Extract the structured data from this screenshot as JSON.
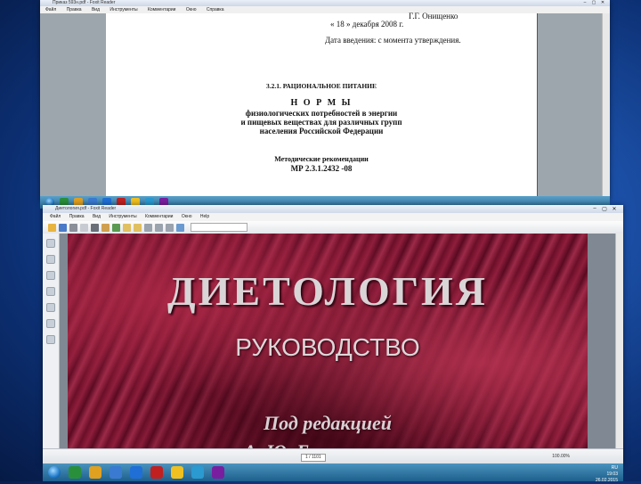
{
  "top_window": {
    "title": "Приказ 593н.pdf - Foxit Reader",
    "menu": [
      "Файл",
      "Правка",
      "Вид",
      "Инструменты",
      "Комментарии",
      "Окно",
      "Справка"
    ],
    "document": {
      "signatory": "Г.Г. Онищенко",
      "date_line": "«   18   » декабря 2008 г.",
      "effective": "Дата введения: с момента утверждения.",
      "section": "3.2.1. РАЦИОНАЛЬНОЕ ПИТАНИЕ",
      "heading": "Н О Р М Ы",
      "subtitle_1": "физиологических потребностей в энергии",
      "subtitle_2": "и пищевых веществах для различных групп",
      "subtitle_3": "населения Российской Федерации",
      "method_1": "Методические рекомендации",
      "method_2": "МР 2.3.1.2432 -08"
    }
  },
  "bottom_window": {
    "title": "Диетология.pdf - Foxit Reader",
    "menu": [
      "Файл",
      "Правка",
      "Вид",
      "Инструменты",
      "Комментарии",
      "Окно",
      "Help"
    ],
    "cover": {
      "title": "ДИЕТОЛОГИЯ",
      "subtitle": "РУКОВОДСТВО",
      "editor_line_1": "Под редакцией",
      "editor_line_2": "А. Ю. Барановского"
    },
    "status": {
      "page": "1 / 1101",
      "zoom": "100.00%"
    }
  },
  "taskbar": {
    "time": "19:03",
    "date": "26.02.2015",
    "language": "RU"
  },
  "icon_colors": {
    "taskbar": [
      "#2a8f3a",
      "#e0a020",
      "#3a7ad0",
      "#1f6fd6",
      "#c02020",
      "#f0c020",
      "#2a9ad0",
      "#7a1ea0"
    ]
  }
}
